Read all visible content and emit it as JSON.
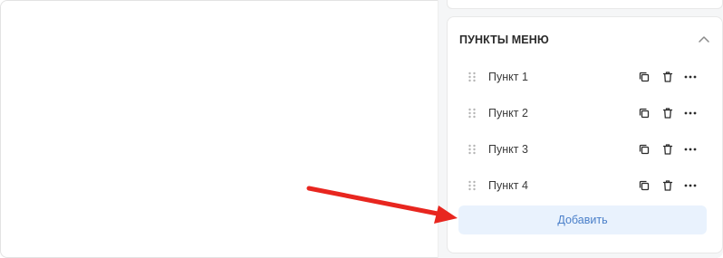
{
  "panel": {
    "section_title": "ПУНКТЫ МЕНЮ",
    "items": [
      {
        "label": "Пункт 1"
      },
      {
        "label": "Пункт 2"
      },
      {
        "label": "Пункт 3"
      },
      {
        "label": "Пункт 4"
      }
    ],
    "add_label": "Добавить"
  },
  "icons": {
    "drag": "drag-handle-icon",
    "copy": "copy-icon",
    "delete": "trash-icon",
    "more": "more-horizontal-icon",
    "collapse": "chevron-up-icon"
  },
  "colors": {
    "annotation_arrow": "#e8261f",
    "add_button_bg": "#e9f2fd",
    "add_button_text": "#4a7fc9"
  }
}
